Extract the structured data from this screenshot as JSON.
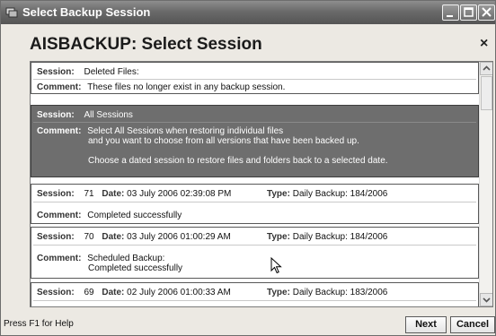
{
  "window": {
    "title": "Select Backup Session"
  },
  "dialog": {
    "heading": "AISBACKUP: Select Session",
    "close_glyph": "×"
  },
  "labels": {
    "session": "Session:",
    "comment": "Comment:",
    "date": "Date:",
    "type": "Type:"
  },
  "sessions": [
    {
      "session": "Deleted Files:",
      "comment": [
        "These files no longer exist in any backup session."
      ],
      "selected": false
    },
    {
      "session": "All Sessions",
      "comment": [
        "Select All Sessions when restoring individual files",
        "and you want to choose from all versions that have been backed up.",
        "Choose a dated session to restore files and folders back to a selected date."
      ],
      "selected": true
    },
    {
      "session": "71",
      "date": "03 July 2006 02:39:08 PM",
      "type": "Daily Backup: 184/2006",
      "comment": [
        "Completed successfully"
      ],
      "selected": false
    },
    {
      "session": "70",
      "date": "03 July 2006 01:00:29 AM",
      "type": "Daily Backup: 184/2006",
      "comment": [
        "Scheduled Backup:",
        "Completed successfully"
      ],
      "selected": false
    },
    {
      "session": "69",
      "date": "02 July 2006 01:00:33 AM",
      "type": "Daily Backup: 183/2006",
      "comment": [],
      "selected": false
    }
  ],
  "statusbar": {
    "help": "Press F1 for Help"
  },
  "buttons": {
    "next": "Next",
    "cancel": "Cancel"
  },
  "colors": {
    "selected_bg": "#6e6e6e",
    "title_bg": "#6a6a6a"
  },
  "icons": [
    "app-icon",
    "minimize-icon",
    "maximize-icon",
    "close-icon",
    "scroll-up-icon",
    "scroll-down-icon",
    "mouse-cursor-icon"
  ]
}
